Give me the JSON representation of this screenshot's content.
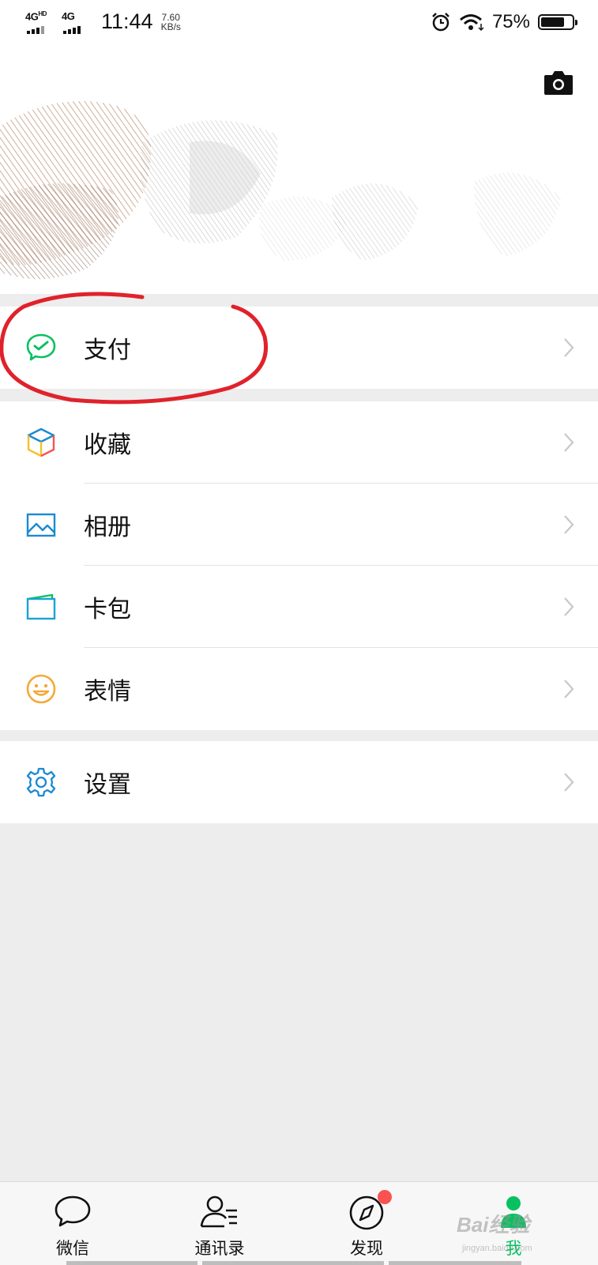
{
  "status_bar": {
    "network1": "4G",
    "network1_sup": "HD",
    "network2": "4G",
    "time": "11:44",
    "speed_value": "7.60",
    "speed_unit": "KB/s",
    "battery_percent": "75%",
    "battery_level": 0.75
  },
  "header": {
    "camera_icon": "camera-icon"
  },
  "menu": {
    "pay": {
      "label": "支付",
      "icon": "wechat-pay-icon",
      "color": "#07c160"
    },
    "favorites": {
      "label": "收藏",
      "icon": "cube-icon"
    },
    "album": {
      "label": "相册",
      "icon": "picture-icon",
      "color": "#1a8ad3"
    },
    "cards": {
      "label": "卡包",
      "icon": "card-wallet-icon",
      "color": "#1aa3d3"
    },
    "stickers": {
      "label": "表情",
      "icon": "smiley-icon",
      "color": "#f4a93a"
    },
    "settings": {
      "label": "设置",
      "icon": "gear-icon",
      "color": "#1a8ad3"
    }
  },
  "tabbar": {
    "tabs": [
      {
        "label": "微信",
        "icon": "chat-bubble-icon"
      },
      {
        "label": "通讯录",
        "icon": "contacts-icon"
      },
      {
        "label": "发现",
        "icon": "compass-icon",
        "badge": true
      },
      {
        "label": "我",
        "icon": "person-icon",
        "active": true
      }
    ],
    "active_color": "#07c160"
  },
  "watermark": {
    "text": "Bai经验",
    "sub": "jingyan.baidu.com"
  },
  "annotation_color": "#e0222b"
}
